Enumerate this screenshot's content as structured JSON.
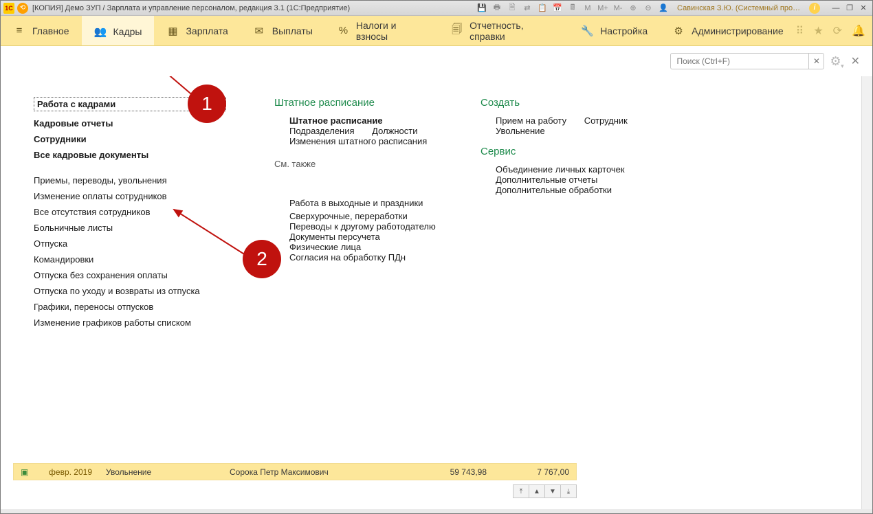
{
  "titlebar": {
    "title": "[КОПИЯ] Демо ЗУП / Зарплата и управление персоналом, редакция 3.1  (1С:Предприятие)",
    "user": "Савинская З.Ю. (Системный прог…",
    "mem": {
      "m": "M",
      "mplus": "M+",
      "mminus": "M-"
    }
  },
  "toolbar": {
    "items": [
      {
        "label": "Главное",
        "icon": "≡"
      },
      {
        "label": "Кадры",
        "icon": "👥"
      },
      {
        "label": "Зарплата",
        "icon": "▦"
      },
      {
        "label": "Выплаты",
        "icon": "✉"
      },
      {
        "label": "Налоги и взносы",
        "icon": "%"
      },
      {
        "label": "Отчетность, справки",
        "icon": "🗐"
      },
      {
        "label": "Настройка",
        "icon": "🔧"
      },
      {
        "label": "Администрирование",
        "icon": "⚙"
      }
    ]
  },
  "search": {
    "placeholder": "Поиск (Ctrl+F)"
  },
  "col_left": {
    "boxed": "Работа с кадрами",
    "bold": [
      "Кадровые отчеты",
      "Сотрудники",
      "Все кадровые документы"
    ],
    "links": [
      "Приемы, переводы, увольнения",
      "Изменение оплаты сотрудников",
      "Все отсутствия сотрудников",
      "Больничные листы",
      "Отпуска",
      "Командировки",
      "Отпуска без сохранения оплаты",
      "Отпуска по уходу и возвраты из отпуска",
      "Графики, переносы отпусков",
      "Изменение графиков работы списком"
    ]
  },
  "col_mid": {
    "group_title": "Штатное расписание",
    "bold0": "Штатное расписание",
    "links1": [
      "Подразделения",
      "Должности",
      "Изменения штатного расписания"
    ],
    "see_also": "См. также",
    "links2": [
      "Работа в выходные и праздники",
      "Сверхурочные, переработки",
      "Переводы к другому работодателю",
      "Документы персучета",
      "Физические лица",
      "Согласия на обработку ПДн"
    ]
  },
  "col_right": {
    "create_title": "Создать",
    "create": [
      "Прием на работу",
      "Сотрудник",
      "Увольнение"
    ],
    "service_title": "Сервис",
    "service": [
      "Объединение личных карточек",
      "Дополнительные отчеты",
      "Дополнительные обработки"
    ]
  },
  "callouts": {
    "one": "1",
    "two": "2"
  },
  "row": {
    "date": "февр. 2019",
    "type": "Увольнение",
    "name": "Сорока Петр Максимович",
    "num1": "59 743,98",
    "num2": "7 767,00"
  }
}
